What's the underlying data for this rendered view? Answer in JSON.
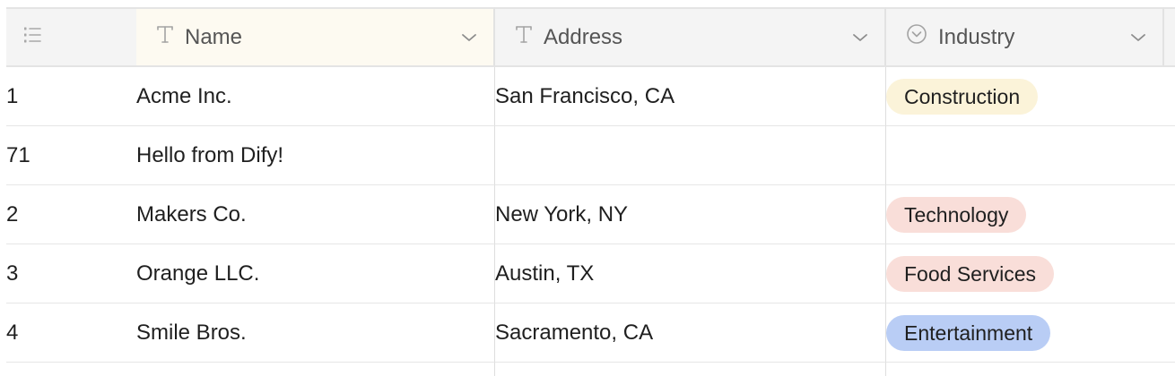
{
  "columns": {
    "name": "Name",
    "address": "Address",
    "industry": "Industry"
  },
  "rows": [
    {
      "id": "1",
      "name": "Acme Inc.",
      "address": "San Francisco, CA",
      "industry": "Construction",
      "tag_color": "#fbf3d9"
    },
    {
      "id": "71",
      "name": "Hello from Dify!",
      "address": "",
      "industry": "",
      "tag_color": ""
    },
    {
      "id": "2",
      "name": "Makers Co.",
      "address": "New York, NY",
      "industry": "Technology",
      "tag_color": "#f9ded9"
    },
    {
      "id": "3",
      "name": "Orange LLC.",
      "address": "Austin, TX",
      "industry": "Food Services",
      "tag_color": "#f9ded9"
    },
    {
      "id": "4",
      "name": "Smile Bros.",
      "address": "Sacramento, CA",
      "industry": "Entertainment",
      "tag_color": "#b9cdf5"
    }
  ],
  "icons": {
    "row_number": "numbered-list-icon",
    "text_type": "text-type-icon",
    "select_type": "single-select-icon",
    "chevron": "chevron-down-icon"
  },
  "colors": {
    "header_bg": "#f4f4f4",
    "selected_header_bg": "#fdfaf1"
  }
}
